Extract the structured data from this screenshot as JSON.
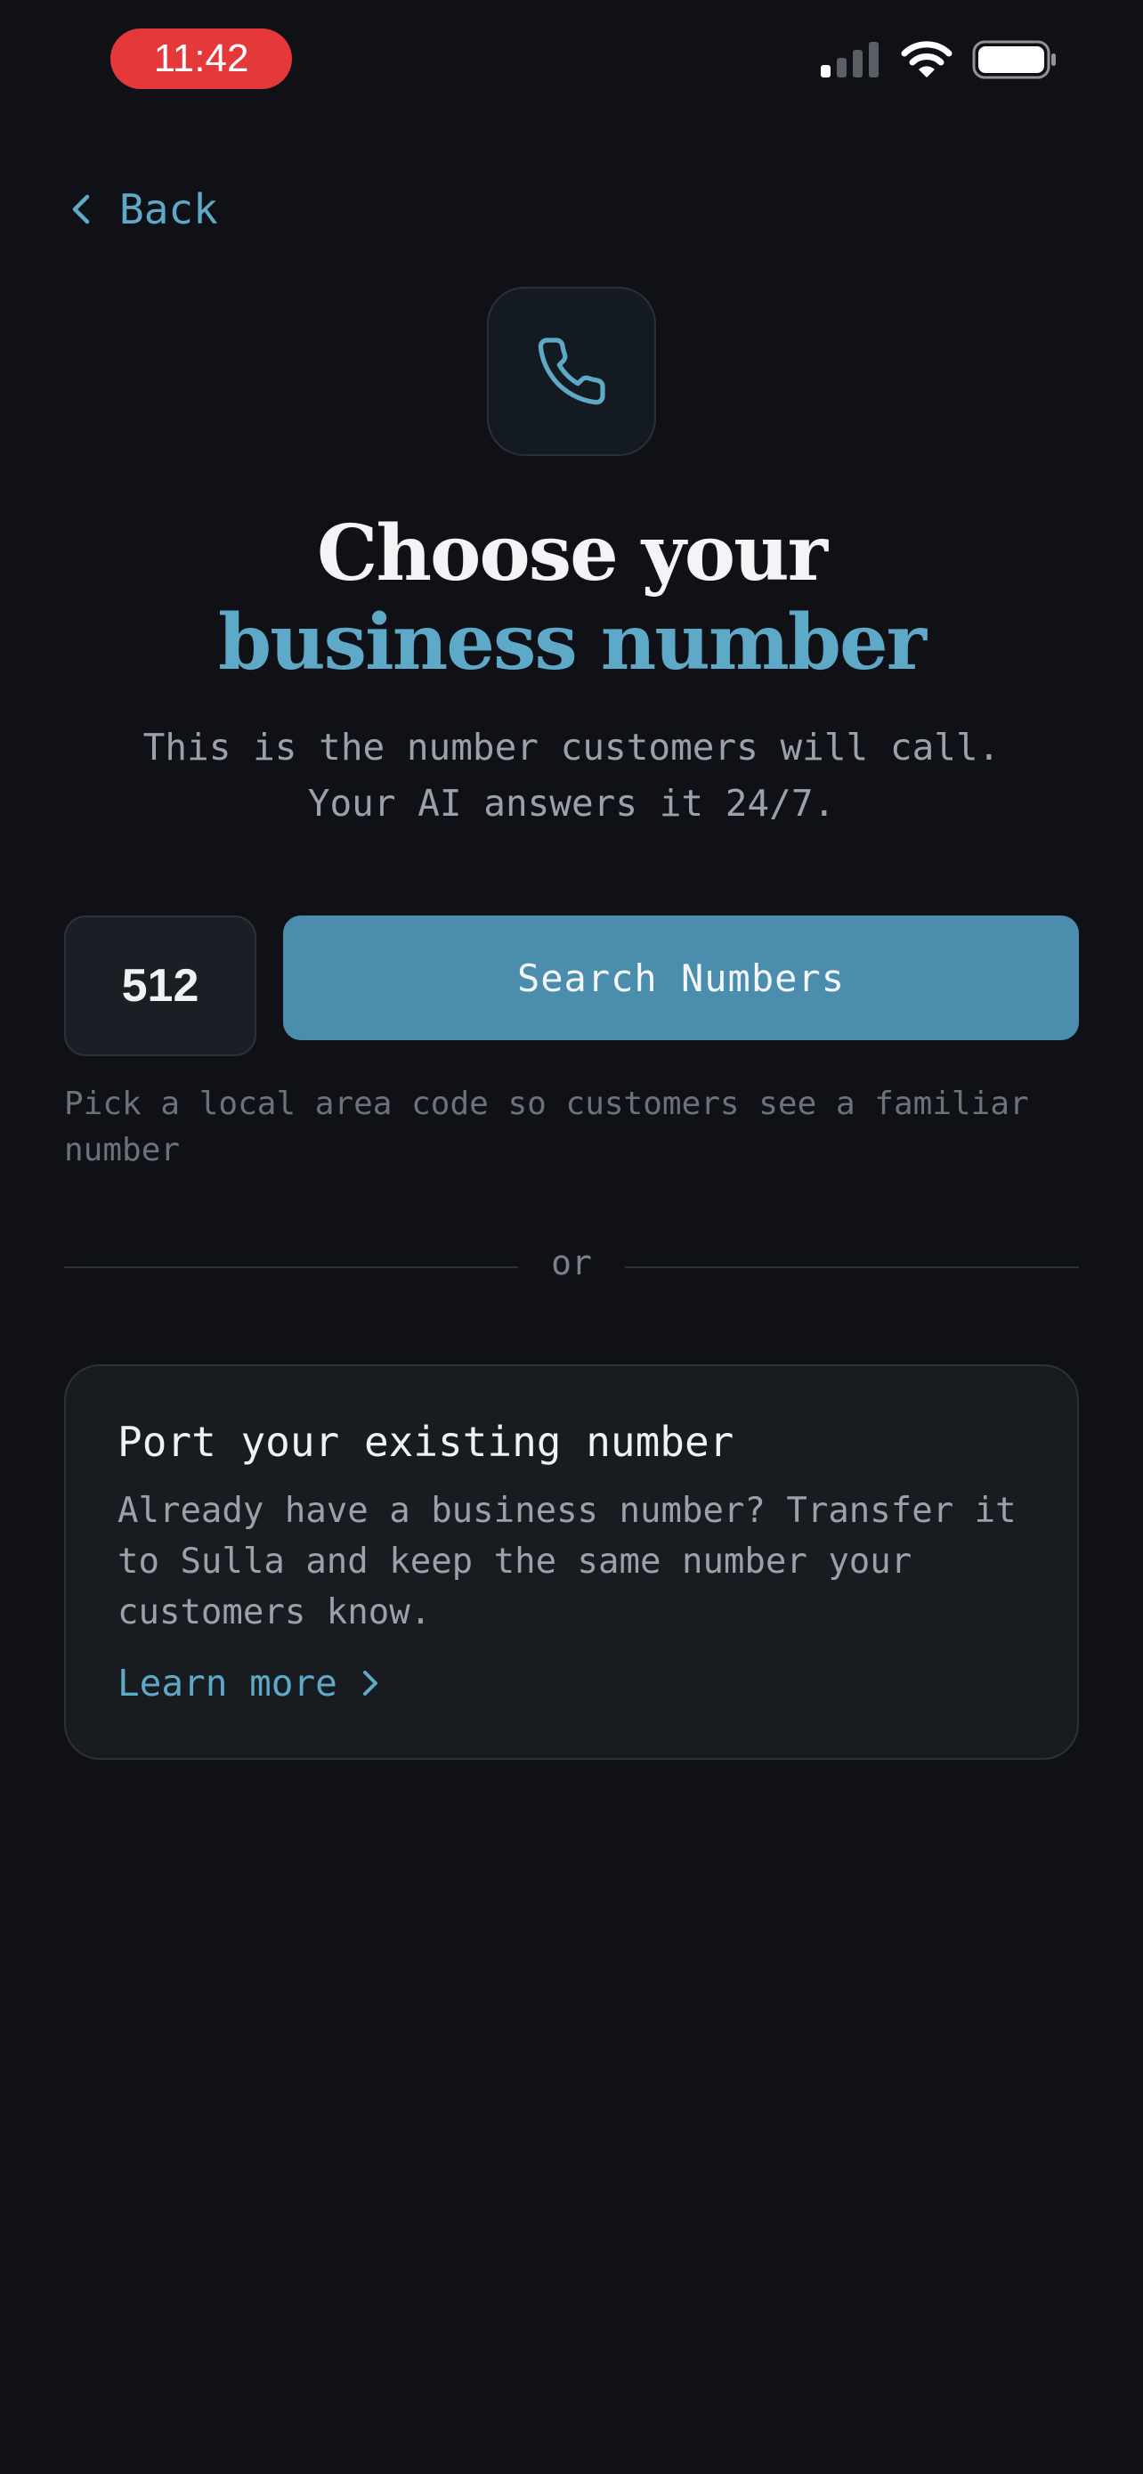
{
  "status_bar": {
    "time": "11:42"
  },
  "nav": {
    "back_label": "Back"
  },
  "header": {
    "title_line1": "Choose your",
    "title_line2": "business number",
    "subtitle_line1": "This is the number customers will call.",
    "subtitle_line2": "Your AI answers it 24/7."
  },
  "search": {
    "area_code": "512",
    "button_label": "Search Numbers",
    "hint": "Pick a local area code so customers see a familiar number"
  },
  "divider_label": "or",
  "port_card": {
    "title": "Port your existing number",
    "description": "Already have a business number? Transfer it to Sulla and keep the same number your customers know.",
    "link_label": "Learn more"
  },
  "icons": {
    "back": "chevron-left-icon",
    "phone": "phone-icon",
    "learn_more": "chevron-right-icon"
  },
  "colors": {
    "background": "#0f1116",
    "accent": "#5fa9c8",
    "button": "#4a8dad",
    "time_pill": "#e5383b"
  }
}
